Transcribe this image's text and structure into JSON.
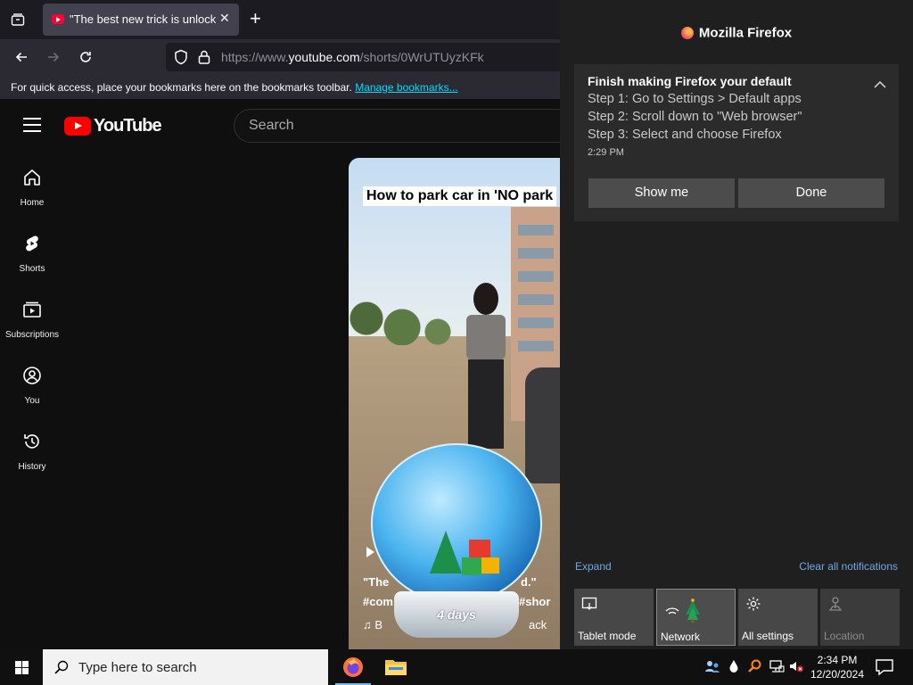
{
  "browser": {
    "tab_title": "\"The best new trick is unlocked",
    "url_prefix": "https://www.",
    "url_domain": "youtube.com",
    "url_path": "/shorts/0WrUTUyzKFk",
    "bookmarks_msg": "For quick access, place your bookmarks here on the bookmarks toolbar.",
    "bookmarks_link": "Manage bookmarks..."
  },
  "youtube": {
    "logo_text": "YouTube",
    "search_placeholder": "Search",
    "nav": [
      {
        "label": "Home"
      },
      {
        "label": "Shorts"
      },
      {
        "label": "Subscriptions"
      },
      {
        "label": "You"
      },
      {
        "label": "History"
      }
    ],
    "short": {
      "caption": "How to park car in 'NO park",
      "desc": "\"The",
      "desc_right": "d.\"",
      "tags": "#com",
      "tags_right": "#shor",
      "music_left": "B",
      "music_right": "ack"
    }
  },
  "widget": {
    "countdown": "4 days"
  },
  "notification_center": {
    "app_name": "Mozilla Firefox",
    "toast": {
      "title": "Finish making Firefox your default",
      "lines": [
        "Step 1: Go to Settings > Default apps",
        "Step 2: Scroll down to \"Web browser\"",
        "Step 3: Select and choose Firefox"
      ],
      "time": "2:29 PM",
      "show_me": "Show me",
      "done": "Done"
    },
    "expand": "Expand",
    "clear_all": "Clear all notifications",
    "quick_actions": [
      {
        "label": "Tablet mode",
        "icon": "tablet-icon"
      },
      {
        "label": "Network",
        "icon": "network-icon"
      },
      {
        "label": "All settings",
        "icon": "gear-icon"
      },
      {
        "label": "Location",
        "icon": "location-icon"
      }
    ]
  },
  "taskbar": {
    "search_placeholder": "Type here to search",
    "time": "2:34 PM",
    "date": "12/20/2024"
  },
  "colors": {
    "accent_link": "#00ddff",
    "youtube_red": "#ff0000",
    "windows_blue": "#76b9ed"
  }
}
